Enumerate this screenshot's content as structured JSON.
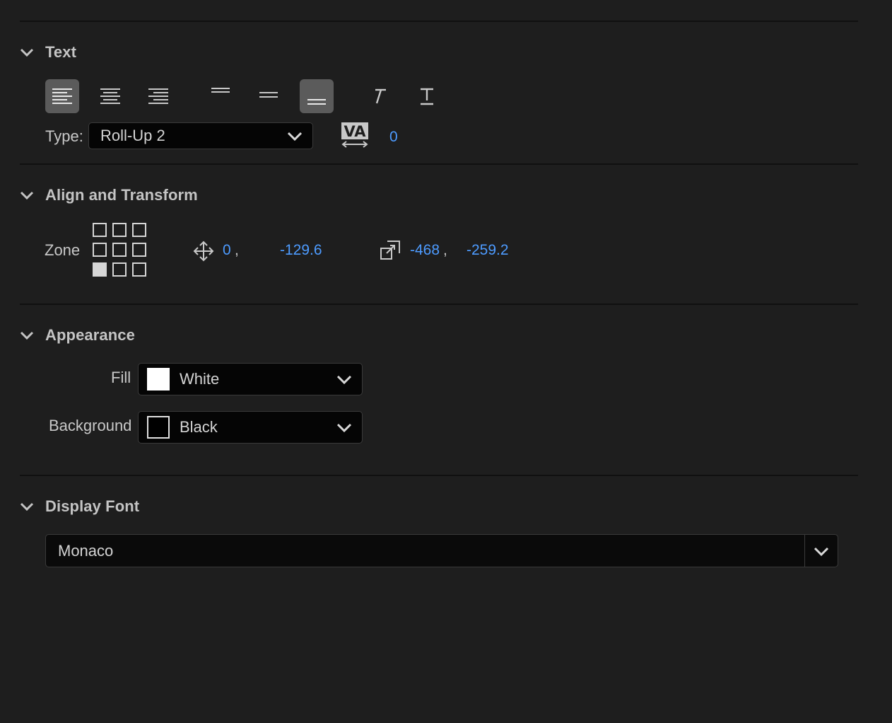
{
  "text_section": {
    "title": "Text",
    "align_buttons": [
      {
        "name": "align-left-icon",
        "active": true
      },
      {
        "name": "align-center-icon",
        "active": false
      },
      {
        "name": "align-right-icon",
        "active": false
      },
      {
        "name": "vertical-align-top-icon",
        "active": false
      },
      {
        "name": "vertical-align-middle-icon",
        "active": false
      },
      {
        "name": "vertical-align-bottom-icon",
        "active": true
      },
      {
        "name": "italic-icon",
        "active": false
      },
      {
        "name": "underline-icon",
        "active": false
      }
    ],
    "type_label": "Type:",
    "type_value": "Roll-Up 2",
    "tracking_icon": "tracking-va-icon",
    "tracking_value": "0"
  },
  "align_transform": {
    "title": "Align and Transform",
    "zone_label": "Zone",
    "zone_selected": "bottom-left",
    "position_x": "0",
    "position_sep": ",",
    "position_y": "-129.6",
    "size_x": "-468",
    "size_sep": ",",
    "size_y": "-259.2"
  },
  "appearance": {
    "title": "Appearance",
    "fill_label": "Fill",
    "fill_value": "White",
    "fill_color": "#ffffff",
    "background_label": "Background",
    "background_value": "Black",
    "background_color": "#000000"
  },
  "display_font": {
    "title": "Display Font",
    "value": "Monaco"
  },
  "colors": {
    "panel_bg": "#1e1e1e",
    "accent_value": "#4d9bff",
    "active_button": "#5b5b5b"
  }
}
